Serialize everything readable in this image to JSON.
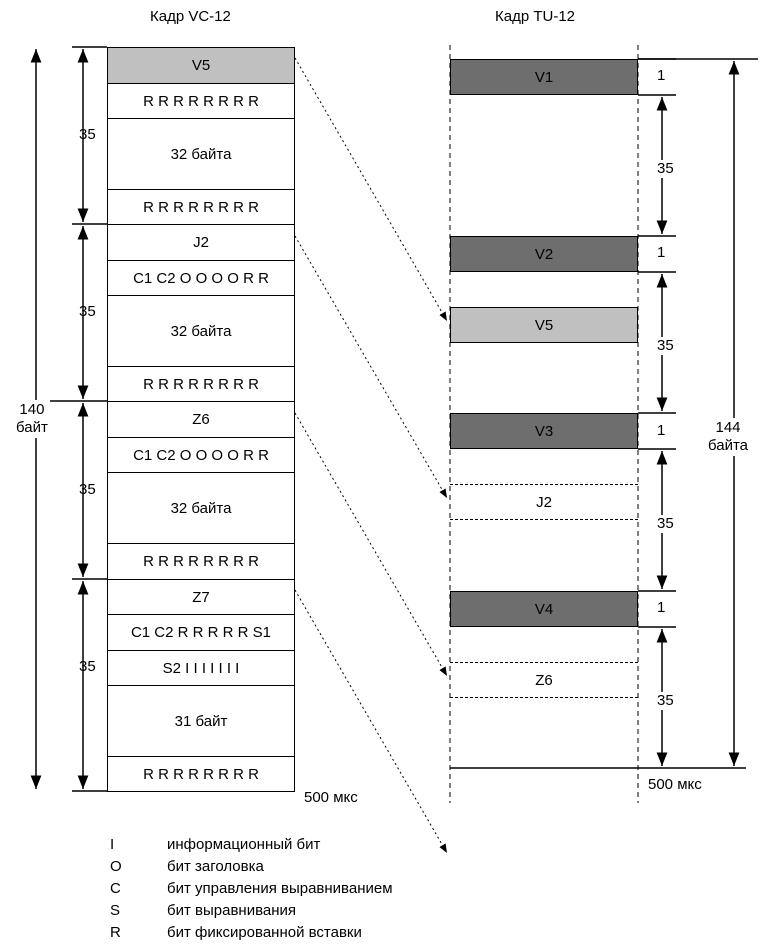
{
  "titles": {
    "vc12": "Кадр VC-12",
    "tu12": "Кадр TU-12"
  },
  "vc12": {
    "rows": [
      {
        "text": "V5",
        "style": "light"
      },
      {
        "text": "R R R R R R R R",
        "style": "white"
      },
      {
        "text": "32 байта",
        "style": "white"
      },
      {
        "text": "R R R R R R R R",
        "style": "white"
      },
      {
        "text": "J2",
        "style": "white"
      },
      {
        "text": "C1 C2 O O O O R R",
        "style": "white"
      },
      {
        "text": "32 байта",
        "style": "white"
      },
      {
        "text": "R R R R R R R R",
        "style": "white"
      },
      {
        "text": "Z6",
        "style": "white"
      },
      {
        "text": "C1 C2 O O O O R R",
        "style": "white"
      },
      {
        "text": "32 байта",
        "style": "white"
      },
      {
        "text": "R R R R R R R R",
        "style": "white"
      },
      {
        "text": "Z7",
        "style": "white"
      },
      {
        "text": "C1 C2 R R R R R S1",
        "style": "white"
      },
      {
        "text": "S2 I I I I I I I",
        "style": "white"
      },
      {
        "text": "31 байт",
        "style": "white"
      },
      {
        "text": "R R R R R R R R",
        "style": "white"
      }
    ],
    "group_labels": [
      "35",
      "35",
      "35",
      "35"
    ],
    "total_label": "140\nбайт",
    "time_label": "500 мкс"
  },
  "tu12": {
    "boxes": [
      {
        "text": "V1",
        "style": "dark"
      },
      {
        "text": "V2",
        "style": "dark"
      },
      {
        "text": "V5",
        "style": "light"
      },
      {
        "text": "V3",
        "style": "dark"
      },
      {
        "text": "J2",
        "style": "dashed"
      },
      {
        "text": "V4",
        "style": "dark"
      },
      {
        "text": "Z6",
        "style": "dashed"
      }
    ],
    "one_labels": [
      "1",
      "1",
      "1",
      "1"
    ],
    "group_labels": [
      "35",
      "35",
      "35",
      "35"
    ],
    "total_label": "144\nбайта",
    "time_label": "500 мкс"
  },
  "legend": [
    {
      "symbol": "I",
      "description": "информационный бит"
    },
    {
      "symbol": "O",
      "description": "бит заголовка"
    },
    {
      "symbol": "C",
      "description": "бит управления выравниванием"
    },
    {
      "symbol": "S",
      "description": "бит выравнивания"
    },
    {
      "symbol": "R",
      "description": "бит фиксированной вставки"
    }
  ],
  "colors": {
    "dark": "#6e6e6e",
    "light": "#c0c0c0",
    "line": "#000000"
  }
}
